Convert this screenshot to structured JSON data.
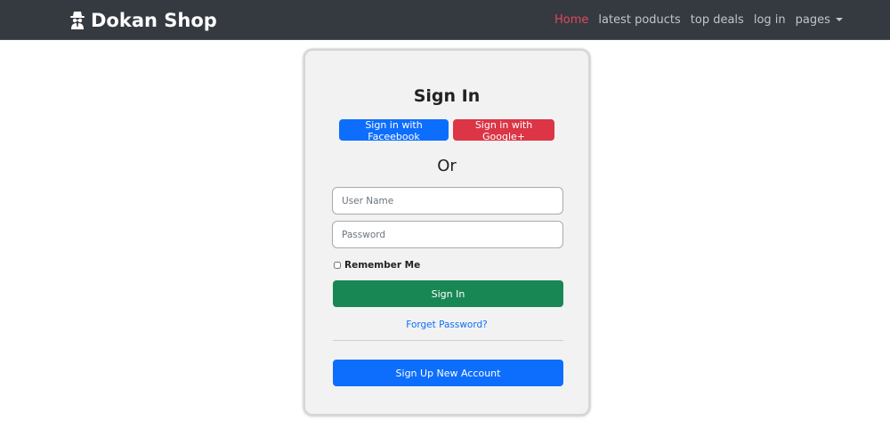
{
  "navbar": {
    "brand": "Dokan Shop",
    "brand_icon": "spy-user-icon",
    "links": [
      {
        "label": "Home",
        "active": true
      },
      {
        "label": "latest poducts",
        "active": false
      },
      {
        "label": "top deals",
        "active": false
      },
      {
        "label": "log in",
        "active": false
      },
      {
        "label": "pages",
        "active": false,
        "dropdown": true
      }
    ]
  },
  "signin": {
    "title": "Sign In",
    "facebook_button": "Sign in with Faceebook",
    "google_button": "Sign in with Google+",
    "or_text": "Or",
    "username_placeholder": "User Name",
    "password_placeholder": "Password",
    "remember_label": "Remember Me",
    "signin_button": "Sign In",
    "forgot_link": "Forget Password?",
    "signup_button": "Sign Up New Account"
  },
  "colors": {
    "navbar_bg": "#343a40",
    "active_link": "#e4475a",
    "facebook": "#0d6efd",
    "google": "#dc3545",
    "success": "#198754",
    "primary": "#0d6efd"
  }
}
